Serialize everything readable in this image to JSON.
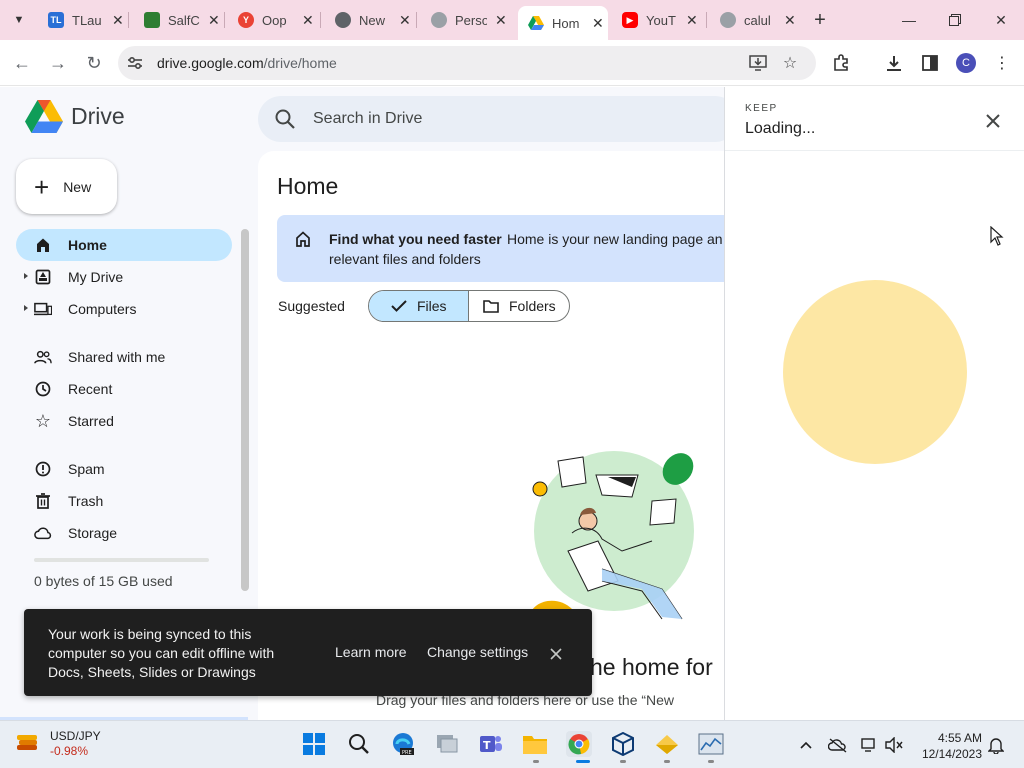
{
  "browser": {
    "tabs": [
      {
        "label": "TLau",
        "fav_text": "TL",
        "fav_color": "#2a6fd6"
      },
      {
        "label": "SalfC",
        "fav_text": "",
        "fav_color": "#2e7d32"
      },
      {
        "label": "Oop",
        "fav_text": "Y",
        "fav_color": "#ea4335"
      },
      {
        "label": "New",
        "fav_text": "",
        "fav_color": "#5f6368"
      },
      {
        "label": "Perso",
        "fav_text": "",
        "fav_color": "#9aa0a6"
      },
      {
        "label": "Hom",
        "fav_text": "",
        "fav_color": "#1a73e8",
        "active": true
      },
      {
        "label": "YouT",
        "fav_text": "",
        "fav_color": "#ff0000"
      },
      {
        "label": "calul",
        "fav_text": "",
        "fav_color": "#9aa0a6"
      }
    ],
    "url_domain": "drive.google.com",
    "url_path": "/drive/home",
    "profile_initial": "C"
  },
  "drive": {
    "logo_text": "Drive",
    "search_placeholder": "Search in Drive",
    "new_label": "New",
    "nav": [
      {
        "label": "Home",
        "icon": "home-icon",
        "active": true
      },
      {
        "label": "My Drive",
        "icon": "my-drive-icon",
        "expandable": true
      },
      {
        "label": "Computers",
        "icon": "computers-icon",
        "expandable": true
      },
      {
        "label": "Shared with me",
        "icon": "shared-icon"
      },
      {
        "label": "Recent",
        "icon": "clock-icon"
      },
      {
        "label": "Starred",
        "icon": "star-icon"
      },
      {
        "label": "Spam",
        "icon": "spam-icon"
      },
      {
        "label": "Trash",
        "icon": "trash-icon"
      },
      {
        "label": "Storage",
        "icon": "cloud-icon"
      }
    ],
    "storage_text": "0 bytes of 15 GB used",
    "main": {
      "title": "Home",
      "banner_title": "Find what you need faster",
      "banner_body": "Home is your new landing page an",
      "banner_body2": "relevant files and folders",
      "suggested_label": "Suggested",
      "filter_files": "Files",
      "filter_folders": "Folders",
      "empty_title": "he home for",
      "empty_sub": "Drag your files and folders here or use the “New"
    }
  },
  "keep_panel": {
    "kicker": "KEEP",
    "title": "Loading..."
  },
  "snackbar": {
    "message": "Your work is being synced to this computer so you can edit offline with Docs, Sheets, Slides or Drawings",
    "learn_more": "Learn more",
    "change_settings": "Change settings"
  },
  "taskbar": {
    "ticker_name": "USD/JPY",
    "ticker_change": "-0.98%",
    "time": "4:55 AM",
    "date": "12/14/2023"
  },
  "colors": {
    "tabstrip": "#f6dbe6",
    "drive_bg": "#f7f8fc",
    "active_nav": "#c2e7ff",
    "banner": "#d3e3fd",
    "keep_spinner": "#fde7a4"
  }
}
